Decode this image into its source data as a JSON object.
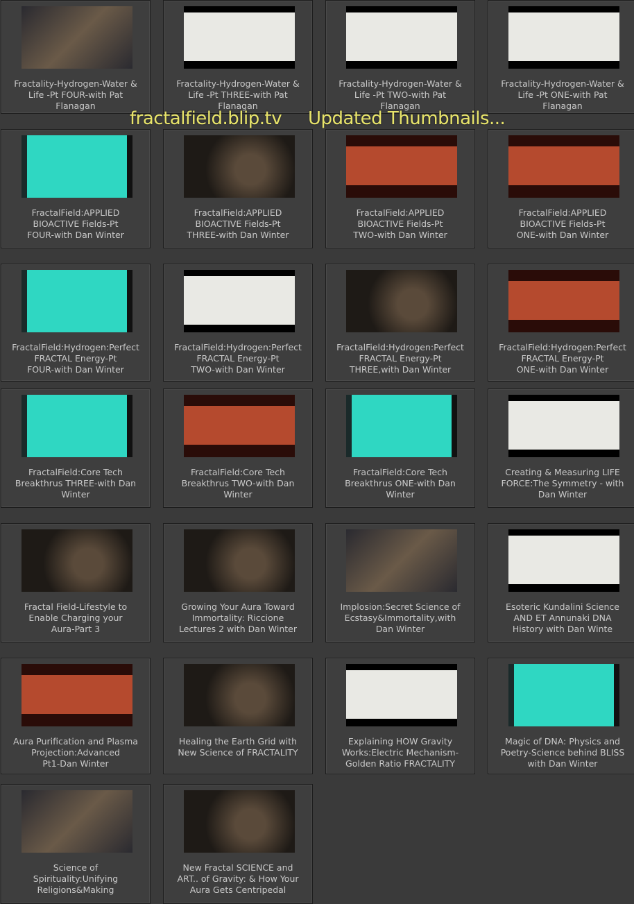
{
  "overlay": {
    "site": "fractalfield.blip.tv",
    "note": "Updated Thumbnails..."
  },
  "videos": [
    {
      "lines": [
        "Fractality-Hydrogen-Water &",
        "Life -Pt FOUR-with Pat",
        "Flanagan"
      ],
      "thumb": "crowd"
    },
    {
      "lines": [
        "Fractality-Hydrogen-Water &",
        "Life -Pt THREE-with Pat",
        "Flanagan"
      ],
      "thumb": "slide-white"
    },
    {
      "lines": [
        "Fractality-Hydrogen-Water &",
        "Life -Pt TWO-with Pat",
        "Flanagan"
      ],
      "thumb": "slide-white"
    },
    {
      "lines": [
        "Fractality-Hydrogen-Water &",
        "Life -Pt ONE-with Pat",
        "Flanagan"
      ],
      "thumb": "slide-white"
    },
    {
      "lines": [
        "FractalField:APPLIED",
        "BIOACTIVE Fields-Pt",
        "FOUR-with Dan Winter"
      ],
      "thumb": "slide-cyan"
    },
    {
      "lines": [
        "FractalField:APPLIED",
        "BIOACTIVE Fields-Pt",
        "THREE-with Dan Winter"
      ],
      "thumb": "room-dark"
    },
    {
      "lines": [
        "FractalField:APPLIED",
        "BIOACTIVE Fields-Pt",
        "TWO-with Dan Winter"
      ],
      "thumb": "proj-red"
    },
    {
      "lines": [
        "FractalField:APPLIED",
        "BIOACTIVE Fields-Pt",
        "ONE-with Dan Winter"
      ],
      "thumb": "proj-red"
    },
    {
      "lines": [
        "FractalField:Hydrogen:Perfect",
        "FRACTAL Energy-Pt",
        "FOUR-with Dan Winter"
      ],
      "thumb": "slide-cyan"
    },
    {
      "lines": [
        "FractalField:Hydrogen:Perfect",
        "FRACTAL Energy-Pt",
        "TWO-with Dan Winter"
      ],
      "thumb": "slide-white"
    },
    {
      "lines": [
        "FractalField:Hydrogen:Perfect",
        "FRACTAL Energy-Pt",
        "THREE,with Dan Winter"
      ],
      "thumb": "room-dark"
    },
    {
      "lines": [
        "FractalField:Hydrogen:Perfect",
        "FRACTAL Energy-Pt",
        "ONE-with Dan Winter"
      ],
      "thumb": "proj-red"
    },
    {
      "lines": [
        "FractalField:Core Tech",
        "Breakthrus THREE-with Dan",
        "Winter"
      ],
      "thumb": "slide-cyan"
    },
    {
      "lines": [
        "FractalField:Core Tech",
        "Breakthrus TWO-with Dan",
        "Winter"
      ],
      "thumb": "proj-red"
    },
    {
      "lines": [
        "FractalField:Core Tech",
        "Breakthrus ONE-with Dan",
        "Winter"
      ],
      "thumb": "slide-cyan"
    },
    {
      "lines": [
        "Creating & Measuring LIFE",
        "FORCE:The Symmetry - with",
        "Dan Winter"
      ],
      "thumb": "slide-white"
    },
    {
      "lines": [
        "Fractal Field-Lifestyle to",
        "Enable Charging your",
        "Aura-Part 3"
      ],
      "thumb": "room-dark"
    },
    {
      "lines": [
        "Growing Your Aura Toward",
        "Immortality: Riccione",
        "Lectures 2 with Dan Winter"
      ],
      "thumb": "room-dark"
    },
    {
      "lines": [
        "Implosion:Secret Science of",
        "Ecstasy&Immortality,with",
        "Dan Winter"
      ],
      "thumb": "crowd"
    },
    {
      "lines": [
        "Esoteric Kundalini Science",
        "AND ET Annunaki DNA",
        "History with Dan Winte"
      ],
      "thumb": "slide-white"
    },
    {
      "lines": [
        "Aura Purification and Plasma",
        "Projection:Advanced",
        "Pt1-Dan Winter"
      ],
      "thumb": "proj-red"
    },
    {
      "lines": [
        "Healing the Earth Grid with",
        "New Science of FRACTALITY"
      ],
      "thumb": "room-dark"
    },
    {
      "lines": [
        "Explaining HOW Gravity",
        "Works:Electric Mechanism-",
        "Golden Ratio FRACTALITY"
      ],
      "thumb": "slide-white"
    },
    {
      "lines": [
        "Magic of DNA: Physics and",
        "Poetry-Science behind BLISS",
        "with Dan Winter"
      ],
      "thumb": "slide-cyan"
    },
    {
      "lines": [
        "Science of",
        "Spirituality:Unifying",
        "Religions&Making"
      ],
      "thumb": "crowd"
    },
    {
      "lines": [
        "New Fractal SCIENCE and",
        "ART.. of Gravity: & How Your",
        "Aura Gets Centripedal"
      ],
      "thumb": "room-dark"
    }
  ]
}
